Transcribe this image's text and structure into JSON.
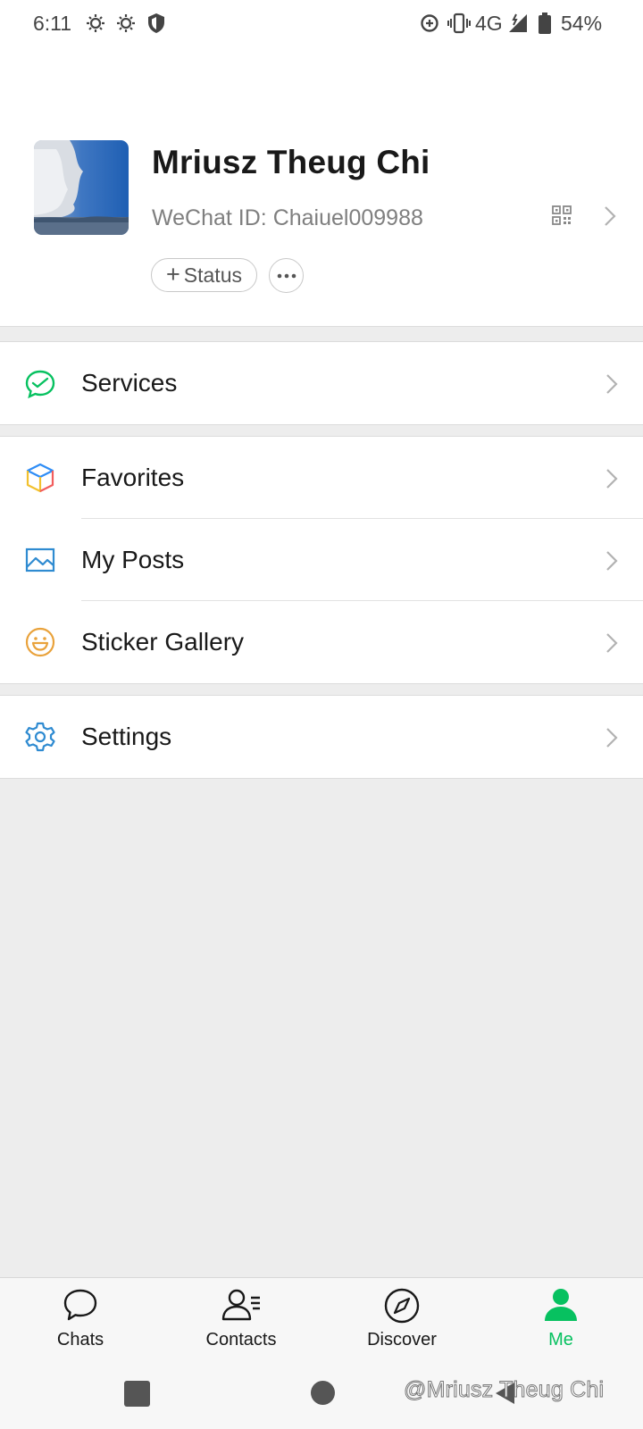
{
  "status_bar": {
    "time": "6:11",
    "network": "4G",
    "battery": "54%",
    "icons": [
      "weather-icon",
      "weather-icon",
      "shield-icon",
      "data-saver-icon",
      "vibrate-icon",
      "signal-icon",
      "battery-icon"
    ]
  },
  "profile": {
    "name": "Mriusz Theug Chi",
    "wechat_id": "WeChat ID: Chaiuel009988",
    "status_label": "Status"
  },
  "menu": {
    "services": "Services",
    "favorites": "Favorites",
    "my_posts": "My Posts",
    "sticker_gallery": "Sticker Gallery",
    "settings": "Settings"
  },
  "tabs": [
    {
      "label": "Chats",
      "active": false
    },
    {
      "label": "Contacts",
      "active": false
    },
    {
      "label": "Discover",
      "active": false
    },
    {
      "label": "Me",
      "active": true
    }
  ],
  "watermark": "@Mriusz Theug Chi",
  "colors": {
    "accent_green": "#07c160",
    "background": "#ededed",
    "card": "#ffffff",
    "favorites_icon": [
      "#2e8df6",
      "#f25d5d",
      "#f2c12e"
    ],
    "posts_icon": "#2f8bd1",
    "sticker_icon": "#e9a23b",
    "settings_icon": "#2f8bd1"
  }
}
